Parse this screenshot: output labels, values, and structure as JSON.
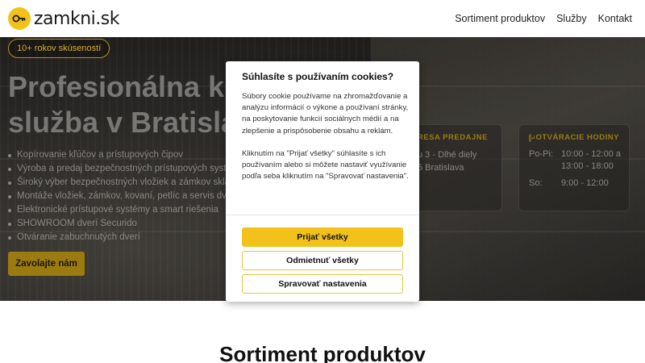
{
  "header": {
    "logo_text": "zamkni.sk",
    "nav": [
      {
        "label": "Sortiment produktov"
      },
      {
        "label": "Služby"
      },
      {
        "label": "Kontakt"
      }
    ]
  },
  "hero": {
    "badge": "10+ rokov skúseností",
    "title_line1": "Profesionálna kľ",
    "title_line2": "služba v Bratisla",
    "services": [
      "Kopírovanie kľúčov a prístupových čipov",
      "Výroba a predaj bezpečnostných prístupových systém",
      "Široký výber bezpečnostných vložiek a zámkov sklado",
      "Montáže vložiek, zámkov, kovaní, petlíc a servis dverí n",
      "Elektronické prístupové systémy a smart riešenia",
      "SHOWROOM dverí Securido",
      "Otváranie zabuchnutých dverí"
    ],
    "cta_label": "Zavolajte nám"
  },
  "address_card": {
    "title": "RESA PREDAJNE",
    "lines": [
      "u 3 - Dlhé diely",
      "5 Bratislava"
    ]
  },
  "hours_card": {
    "title": "OTVÁRACIE HODINY",
    "rows": [
      {
        "day": "Po-Pi:",
        "time1": "10:00 - 12:00 a",
        "time2": "13:00 - 18:00"
      },
      {
        "day": "So:",
        "time1": "9:00 - 12:00",
        "time2": ""
      }
    ]
  },
  "section": {
    "title": "Sortiment produktov"
  },
  "cookie_modal": {
    "title": "Súhlasíte s používaním cookies?",
    "paragraph1": "Súbory cookie používame na zhromažďovanie a analýzu informácií o výkone a používaní stránky, na poskytovanie funkcií sociálnych médií a na zlepšenie a prispôsobenie obsahu a reklám.",
    "paragraph2": "Kliknutím na \"Prijať všetky\" súhlasíte s ich používaním alebo si môžete nastaviť využívanie podľa seba kliknutím na \"Spravovať nastavenia\".",
    "accept_label": "Prijať všetky",
    "reject_label": "Odmietnuť všetky",
    "settings_label": "Spravovať nastavenia"
  },
  "colors": {
    "brand_yellow": "#f2c21b",
    "hero_dark": "#2f2d2a"
  }
}
